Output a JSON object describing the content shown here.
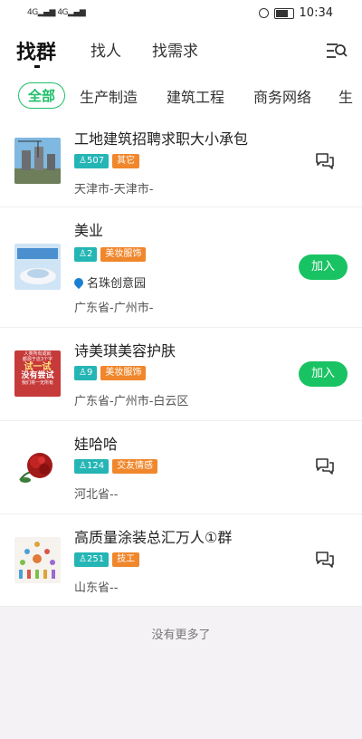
{
  "status": {
    "signal1": "4G",
    "signal2": "4G",
    "time": "10:34"
  },
  "nav": {
    "tabs": [
      "找群",
      "找人",
      "找需求"
    ]
  },
  "categories": [
    "全部",
    "生产制造",
    "建筑工程",
    "商务网络",
    "生"
  ],
  "items": [
    {
      "title": "工地建筑招聘求职大小承包",
      "count": "507",
      "category": "其它",
      "location": "天津市-天津市-",
      "action": "chat"
    },
    {
      "title": "美业",
      "count": "2",
      "category": "美妆服饰",
      "address": "名珠创意园",
      "location": "广东省-广州市-",
      "action": "加入"
    },
    {
      "title": "诗美琪美容护肤",
      "count": "9",
      "category": "美妆服饰",
      "location": "广东省-广州市-白云区",
      "action": "加入",
      "thumb_text": [
        "人类所有成就",
        "都源于这3个字",
        "试一试",
        "没有尝试",
        "我们将一无所有"
      ]
    },
    {
      "title": "娃哈哈",
      "count": "124",
      "category": "交友情感",
      "location": "河北省--",
      "action": "chat"
    },
    {
      "title": "高质量涂装总汇万人①群",
      "count": "251",
      "category": "技工",
      "location": "山东省--",
      "action": "chat"
    }
  ],
  "footer": {
    "no_more": "没有更多了"
  },
  "colors": {
    "accent": "#19c363",
    "count_badge": "#25b5b5",
    "cat_badge": "#f0872c"
  }
}
